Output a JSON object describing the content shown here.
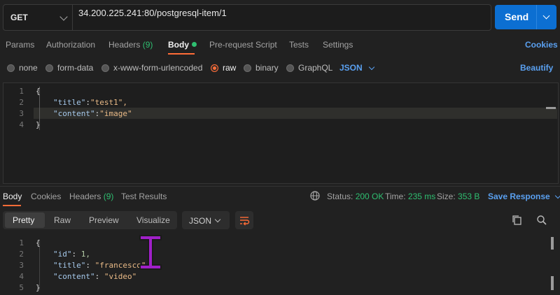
{
  "request": {
    "method": "GET",
    "url": "34.200.225.241:80/postgresql-item/1",
    "send_label": "Send"
  },
  "request_tabs": {
    "params": "Params",
    "authorization": "Authorization",
    "headers": "Headers",
    "headers_count": "(9)",
    "body": "Body",
    "pre_request": "Pre-request Script",
    "tests": "Tests",
    "settings": "Settings",
    "cookies": "Cookies"
  },
  "body_types": {
    "none": "none",
    "form_data": "form-data",
    "urlencoded": "x-www-form-urlencoded",
    "raw": "raw",
    "binary": "binary",
    "graphql": "GraphQL",
    "format": "JSON",
    "beautify": "Beautify",
    "selected": "raw"
  },
  "request_body": {
    "line_numbers": [
      "1",
      "2",
      "3",
      "4"
    ],
    "open_brace": "{",
    "close_brace": "}",
    "title_key": "\"title\"",
    "title_value": "\"test1\",",
    "content_key": "\"content\"",
    "content_value": "\"image\""
  },
  "response_tabs": {
    "body": "Body",
    "cookies": "Cookies",
    "headers": "Headers",
    "headers_count": "(9)",
    "test_results": "Test Results"
  },
  "response_status": {
    "status_label": "Status:",
    "status_value": "200 OK",
    "time_label": "Time:",
    "time_value": "235 ms",
    "size_label": "Size:",
    "size_value": "353 B",
    "save_response": "Save Response"
  },
  "response_view": {
    "pretty": "Pretty",
    "raw": "Raw",
    "preview": "Preview",
    "visualize": "Visualize",
    "format": "JSON"
  },
  "response_body": {
    "line_numbers": [
      "1",
      "2",
      "3",
      "4",
      "5"
    ],
    "open_brace": "{",
    "close_brace": "}",
    "id_key": "\"id\"",
    "id_value": "1,",
    "title_key": "\"title\"",
    "title_value": "\"francesco\",",
    "content_key": "\"content\"",
    "content_value": "\"video\""
  },
  "colors": {
    "accent": "#ff6c37",
    "link": "#5aa0f0",
    "success": "#2fbf71",
    "send": "#0c6fd2"
  }
}
